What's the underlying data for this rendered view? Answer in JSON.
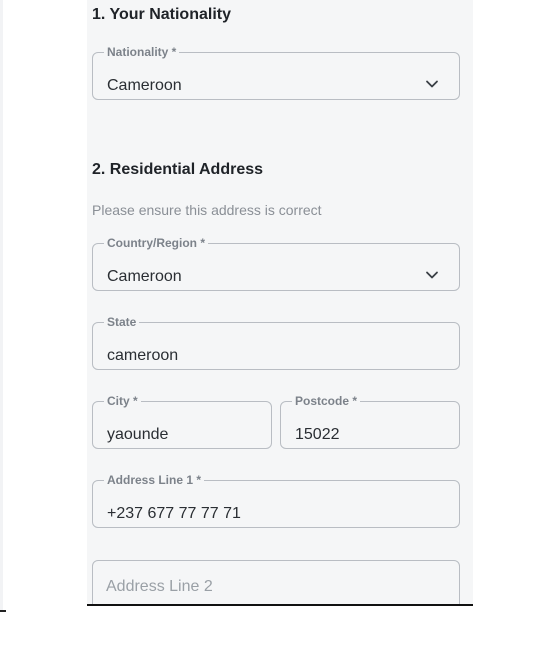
{
  "nationality_section": {
    "title": "1. Your Nationality",
    "nationality": {
      "label": "Nationality *",
      "value": "Cameroon"
    }
  },
  "address_section": {
    "title": "2. Residential Address",
    "hint": "Please ensure this address is correct",
    "country": {
      "label": "Country/Region *",
      "value": "Cameroon"
    },
    "state": {
      "label": "State",
      "value": "cameroon"
    },
    "city": {
      "label": "City *",
      "value": "yaounde"
    },
    "postcode": {
      "label": "Postcode *",
      "value": "15022"
    },
    "address_line_1": {
      "label": "Address Line 1 *",
      "value": "+237 677 77 77 71"
    },
    "address_line_2": {
      "placeholder": "Address Line 2",
      "value": ""
    }
  },
  "icons": {
    "dropdown": "chevron-down-icon"
  },
  "colors": {
    "panel_bg": "#f5f6f7",
    "border": "#b9bdc3",
    "text": "#2a2e33",
    "label": "#7c828a"
  }
}
